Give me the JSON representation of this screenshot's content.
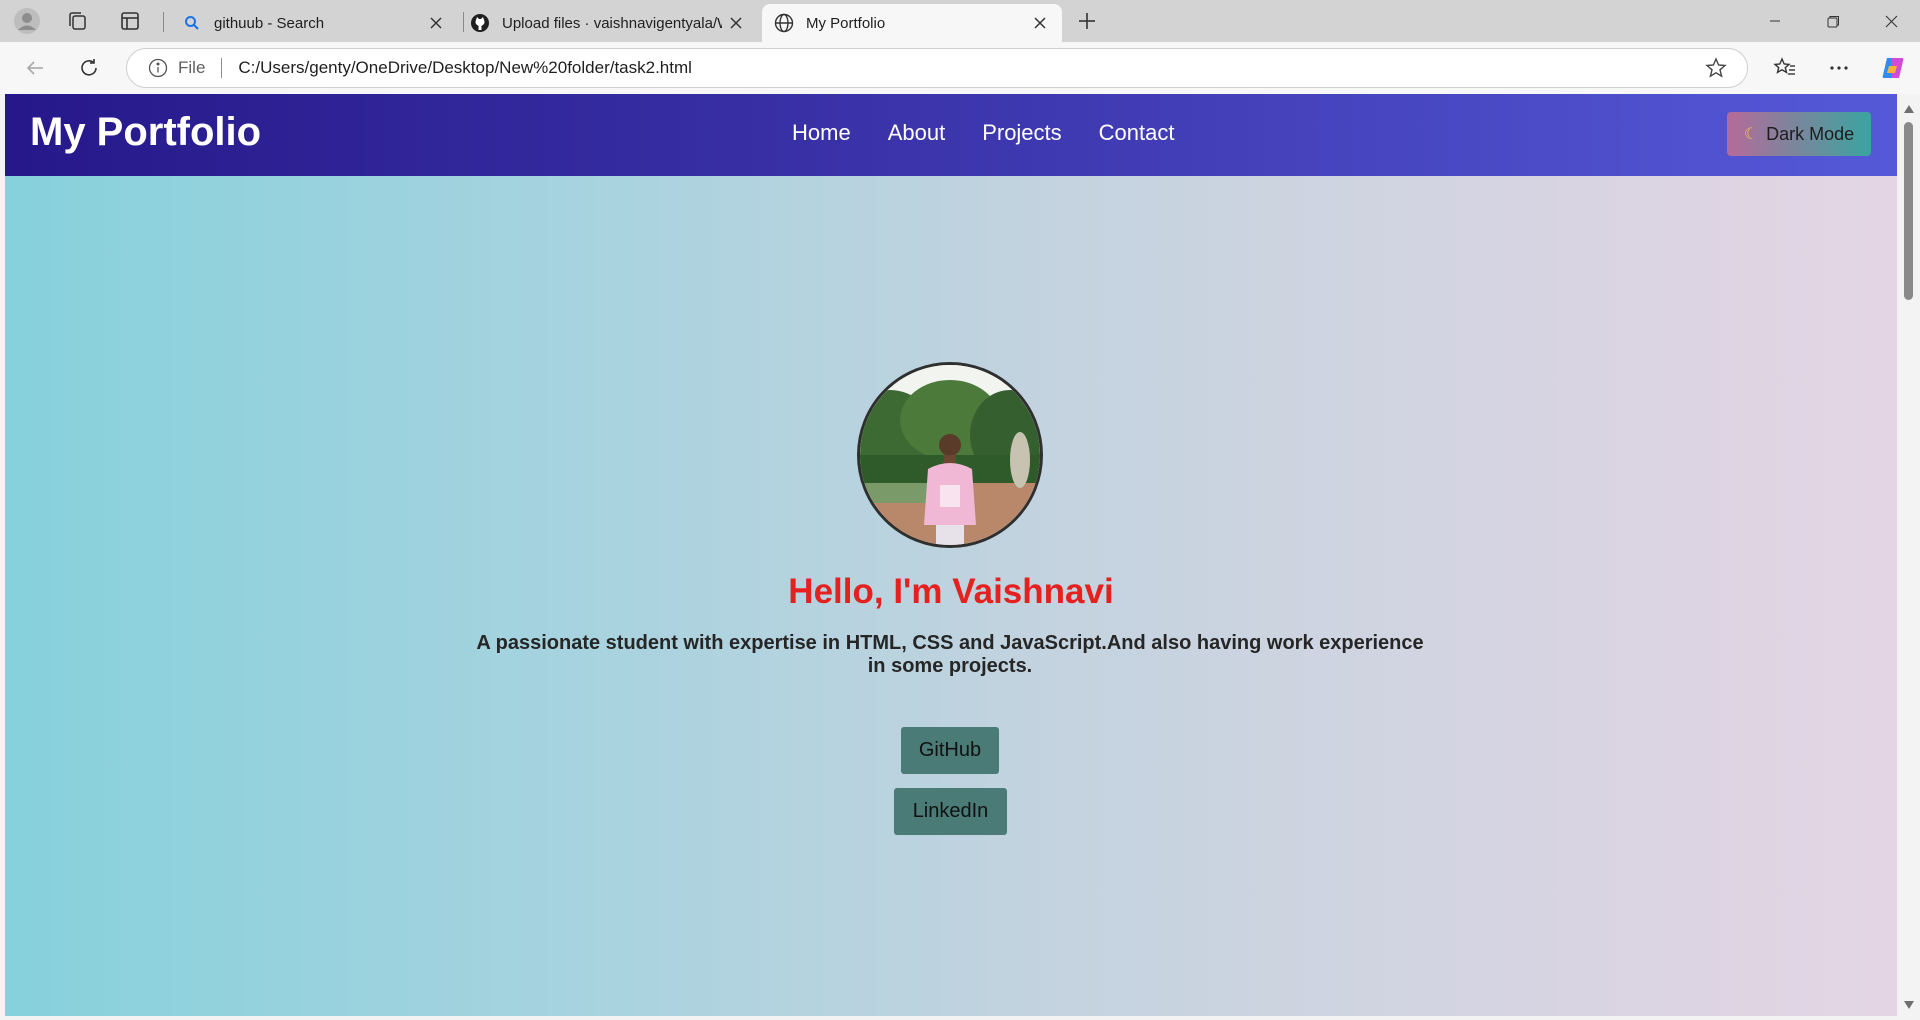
{
  "browser": {
    "tabs": [
      {
        "title": "githuub - Search",
        "icon": "search-icon",
        "active": false
      },
      {
        "title": "Upload files · vaishnavigentyala/W",
        "icon": "github-icon",
        "active": false
      },
      {
        "title": "My Portfolio",
        "icon": "globe-icon",
        "active": true
      }
    ],
    "address": {
      "scheme_label": "File",
      "url": "C:/Users/genty/OneDrive/Desktop/New%20folder/task2.html"
    }
  },
  "site": {
    "brand": "My Portfolio",
    "nav": [
      "Home",
      "About",
      "Projects",
      "Contact"
    ],
    "mode_toggle": {
      "icon": "moon-icon",
      "label": "Dark Mode"
    },
    "hero": {
      "greeting": "Hello, I'm Vaishnavi",
      "tagline": "A passionate student with expertise in HTML, CSS and JavaScript.And also having work experience in some projects.",
      "buttons": [
        "GitHub",
        "LinkedIn"
      ]
    }
  },
  "colors": {
    "header_start": "#26188a",
    "header_end": "#5559d8",
    "greeting": "#e5211f",
    "link_button": "#4a7b76"
  }
}
